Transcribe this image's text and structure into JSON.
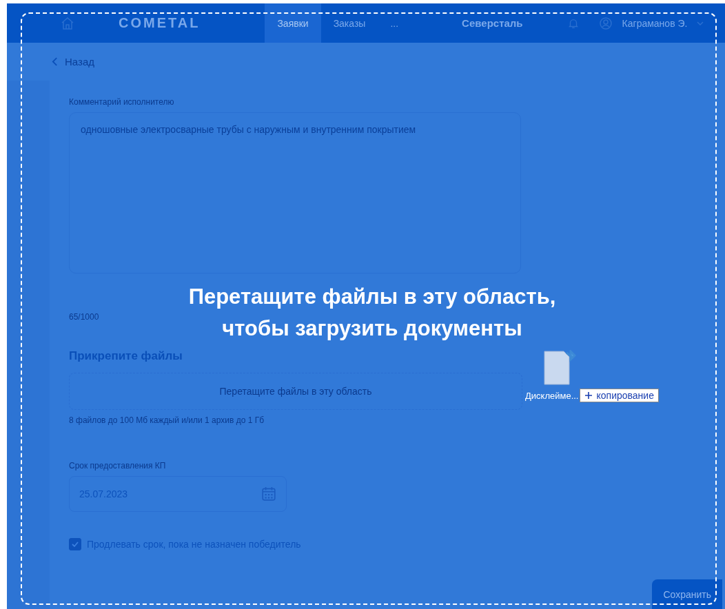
{
  "header": {
    "logo": "COMETAL",
    "nav": [
      {
        "label": "Заявки",
        "selected": true
      },
      {
        "label": "Заказы",
        "selected": false
      },
      {
        "label": "...",
        "selected": false
      }
    ],
    "brand": "Северсталь",
    "user": "Каграманов Э."
  },
  "back": "Назад",
  "comment": {
    "label": "Комментарий исполнителю",
    "value": "одношовные электросварные трубы с наружным и внутренним покрытием",
    "counter": "65/1000"
  },
  "attach": {
    "title": "Прикрепите файлы",
    "dropzone": "Перетащите файлы в эту область",
    "hint": "8 файлов до 100 Мб каждый и/или 1 архив до 1 Гб"
  },
  "deadline": {
    "label": "Срок предоставления КП",
    "value": "25.07.2023"
  },
  "extend": {
    "label": "Продлевать срок, пока не назначен победитель",
    "checked": true
  },
  "save": "Сохранить",
  "drop_overlay": {
    "message_lines": [
      "Перетащите файлы в эту область,",
      "чтобы загрузить документы"
    ],
    "file_name": "Дисклейме...",
    "action": "копирование"
  }
}
